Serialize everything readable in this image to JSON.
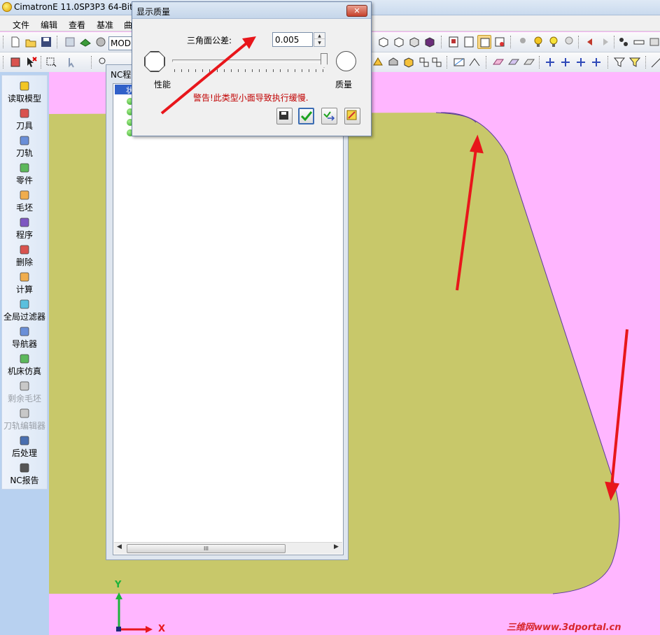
{
  "app": {
    "title": "CimatronE 11.0SP3P3 64-Bit",
    "mode_combo": "MOD"
  },
  "menu": [
    "文件",
    "编辑",
    "查看",
    "基准",
    "曲"
  ],
  "left_panel": [
    {
      "label": "读取模型",
      "icon": "read-model-icon",
      "enabled": true
    },
    {
      "label": "刀具",
      "icon": "tool-icon",
      "enabled": true
    },
    {
      "label": "刀轨",
      "icon": "toolpath-icon",
      "enabled": true
    },
    {
      "label": "零件",
      "icon": "part-icon",
      "enabled": true
    },
    {
      "label": "毛坯",
      "icon": "stock-icon",
      "enabled": true
    },
    {
      "label": "程序",
      "icon": "procedure-icon",
      "enabled": true
    },
    {
      "label": "删除",
      "icon": "delete-icon",
      "enabled": true
    },
    {
      "label": "计算",
      "icon": "execute-icon",
      "enabled": true
    },
    {
      "label": "全局过滤器",
      "icon": "global-filter-icon",
      "enabled": true
    },
    {
      "label": "导航器",
      "icon": "navigator-icon",
      "enabled": true
    },
    {
      "label": "机床仿真",
      "icon": "machine-sim-icon",
      "enabled": true
    },
    {
      "label": "剩余毛坯",
      "icon": "remaining-stock-icon",
      "enabled": false
    },
    {
      "label": "刀轨编辑器",
      "icon": "toolpath-editor-icon",
      "enabled": false
    },
    {
      "label": "后处理",
      "icon": "post-process-icon",
      "enabled": true
    },
    {
      "label": "NC报告",
      "icon": "nc-report-icon",
      "enabled": true
    }
  ],
  "nc_window": {
    "title": "NC程",
    "selected_row": "状",
    "scroll_grip": "III"
  },
  "dialog": {
    "title": "显示质量",
    "close_label": "✕",
    "tolerance_label": "三角面公差:",
    "tolerance_value": "0.005",
    "slider_min_label": "性能",
    "slider_max_label": "质量",
    "slider_level": 1.0,
    "warning": "警告!此类型小面导致执行缓慢.",
    "buttons": [
      "save-icon",
      "ok-check-icon",
      "apply-icon",
      "clear-icon"
    ]
  },
  "axes": {
    "y_label": "Y",
    "x_label": "X"
  },
  "watermark": "三维网www.3dportal.cn",
  "colors": {
    "viewport_bg": "#ffb6ff",
    "part_fill": "#c8c86a",
    "arrow": "#e8161b",
    "warning": "#c00000"
  }
}
